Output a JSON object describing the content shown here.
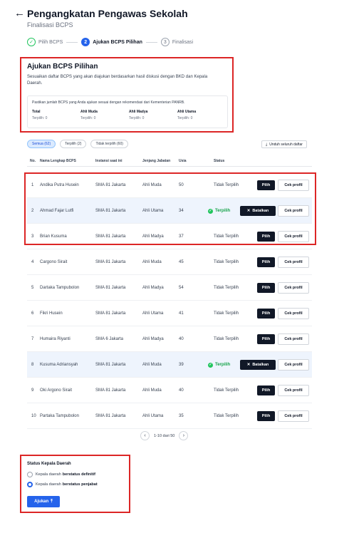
{
  "header": {
    "back_icon": "←",
    "title": "Pengangkatan Pengawas Sekolah",
    "subtitle": "Finalisasi BCPS"
  },
  "stepper": [
    {
      "num": "✓",
      "label": "Pilih BCPS",
      "state": "done"
    },
    {
      "num": "2",
      "label": "Ajukan BCPS Pilihan",
      "state": "active"
    },
    {
      "num": "3",
      "label": "Finalisasi",
      "state": "todo"
    }
  ],
  "info": {
    "title": "Ajukan BCPS Pilihan",
    "desc": "Sesuaikan daftar BCPS yang akan diajukan berdasarkan hasil diskusi dengan BKD dan Kepala Daerah.",
    "note": "Pastikan jumlah BCPS yang Anda ajukan sesuai dengan rekomendasi dari Kementerian PANRB.",
    "cols": [
      {
        "k": "Total",
        "v": "Terpilih: 0"
      },
      {
        "k": "Ahli Muda",
        "v": "Terpilih: 0"
      },
      {
        "k": "Ahli Madya",
        "v": "Terpilih: 0"
      },
      {
        "k": "Ahli Utama",
        "v": "Terpilih: 0"
      }
    ]
  },
  "filters": {
    "all": "Semua (62)",
    "selected": "Terpilih (2)",
    "unselected": "Tidak terpilih (60)",
    "download": "Unduh seluruh daftar",
    "download_icon": "⤓"
  },
  "table": {
    "headers": {
      "no": "No.",
      "name": "Nama Lengkap BCPS",
      "instansi": "Instansi saat ini",
      "jenjang": "Jenjang Jabatan",
      "usia": "Usia",
      "status": "Status"
    },
    "rows": [
      {
        "no": "1",
        "name": "Andika Putra Husein",
        "instansi": "SMA 81 Jakarta",
        "jenjang": "Ahli Muda",
        "usia": "50",
        "selected": false,
        "status": "Tidak Terpilih",
        "action": "Pilih",
        "profile": "Cek profil"
      },
      {
        "no": "2",
        "name": "Ahmad Fajar Lutfi",
        "instansi": "SMA 81 Jakarta",
        "jenjang": "Ahli Utama",
        "usia": "34",
        "selected": true,
        "status": "Terpilih",
        "action": "Batalkan",
        "profile": "Cek profil"
      },
      {
        "no": "3",
        "name": "Brian Kusuma",
        "instansi": "SMA 81 Jakarta",
        "jenjang": "Ahli Madya",
        "usia": "37",
        "selected": false,
        "status": "Tidak Terpilih",
        "action": "Pilih",
        "profile": "Cek profil"
      },
      {
        "no": "4",
        "name": "Cargono Sirait",
        "instansi": "SMA 81 Jakarta",
        "jenjang": "Ahli Muda",
        "usia": "45",
        "selected": false,
        "status": "Tidak Terpilih",
        "action": "Pilih",
        "profile": "Cek profil"
      },
      {
        "no": "5",
        "name": "Dartaka Tampubolon",
        "instansi": "SMA 81 Jakarta",
        "jenjang": "Ahli Madya",
        "usia": "54",
        "selected": false,
        "status": "Tidak Terpilih",
        "action": "Pilih",
        "profile": "Cek profil"
      },
      {
        "no": "6",
        "name": "Fikri Husein",
        "instansi": "SMA 81 Jakarta",
        "jenjang": "Ahli Utama",
        "usia": "41",
        "selected": false,
        "status": "Tidak Terpilih",
        "action": "Pilih",
        "profile": "Cek profil"
      },
      {
        "no": "7",
        "name": "Humaira Riyanti",
        "instansi": "SMA 6 Jakarta",
        "jenjang": "Ahli Madya",
        "usia": "40",
        "selected": false,
        "status": "Tidak Terpilih",
        "action": "Pilih",
        "profile": "Cek profil"
      },
      {
        "no": "8",
        "name": "Kusuma Adriansyah",
        "instansi": "SMA 81 Jakarta",
        "jenjang": "Ahli Muda",
        "usia": "39",
        "selected": true,
        "status": "Terpilih",
        "action": "Batalkan",
        "profile": "Cek profil"
      },
      {
        "no": "9",
        "name": "Oki Argono Sirait",
        "instansi": "SMA 81 Jakarta",
        "jenjang": "Ahli Muda",
        "usia": "40",
        "selected": false,
        "status": "Tidak Terpilih",
        "action": "Pilih",
        "profile": "Cek profil"
      },
      {
        "no": "10",
        "name": "Partaka Tampubolon",
        "instansi": "SMA 81 Jakarta",
        "jenjang": "Ahli Utama",
        "usia": "35",
        "selected": false,
        "status": "Tidak Terpilih",
        "action": "Pilih",
        "profile": "Cek profil"
      }
    ]
  },
  "pagination": {
    "prev": "‹",
    "text": "1-10 dari 50",
    "next": "›"
  },
  "status_kepala": {
    "title": "Status Kepala Daerah",
    "options": [
      {
        "pre": "Kepala daerah",
        "bold": "berstatus definitif",
        "checked": false
      },
      {
        "pre": "Kepala daerah",
        "bold": "berstatus penjabat",
        "checked": true
      }
    ],
    "submit": "Ajukan",
    "submit_icon": "⤒"
  },
  "colors": {
    "accent": "#2563eb",
    "success": "#22c55e",
    "highlight": "#dc2626"
  }
}
